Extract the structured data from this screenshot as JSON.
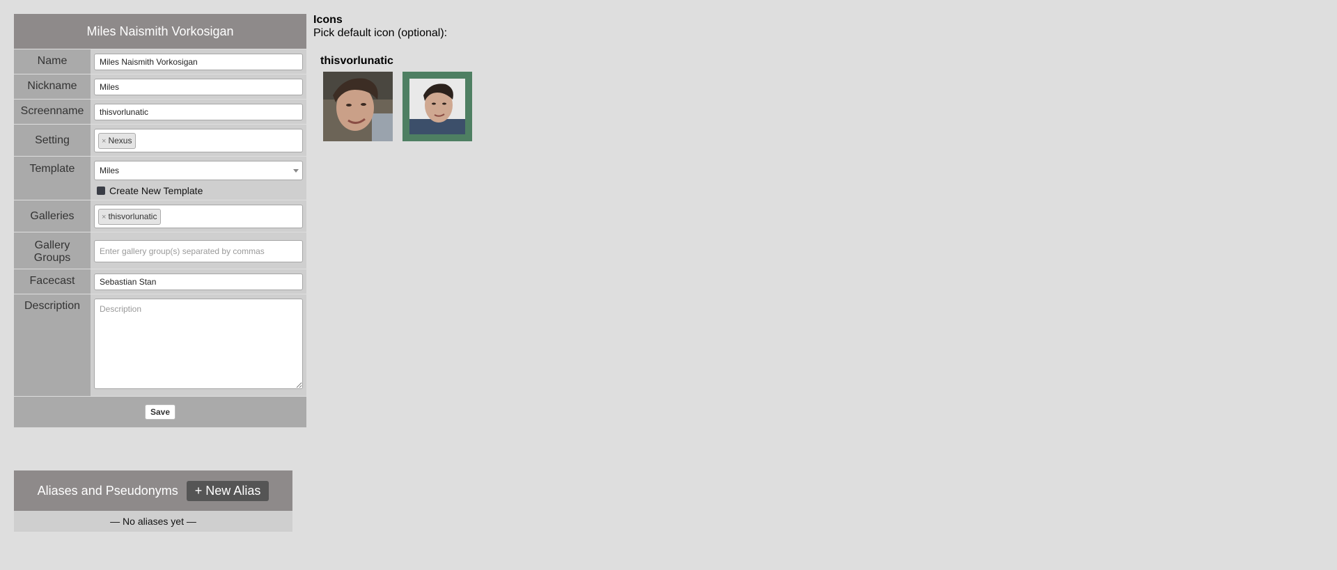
{
  "form": {
    "title": "Miles Naismith Vorkosigan",
    "fields": {
      "name": {
        "label": "Name",
        "value": "Miles Naismith Vorkosigan"
      },
      "nickname": {
        "label": "Nickname",
        "value": "Miles"
      },
      "screenname": {
        "label": "Screenname",
        "value": "thisvorlunatic"
      },
      "setting": {
        "label": "Setting",
        "tags": [
          "Nexus"
        ]
      },
      "template": {
        "label": "Template",
        "value": "Miles",
        "checkbox_label": "Create New Template"
      },
      "galleries": {
        "label": "Galleries",
        "tags": [
          "thisvorlunatic"
        ]
      },
      "gallery_groups": {
        "label": "Gallery Groups",
        "placeholder": "Enter gallery group(s) separated by commas"
      },
      "facecast": {
        "label": "Facecast",
        "value": "Sebastian Stan"
      },
      "description": {
        "label": "Description",
        "placeholder": "Description"
      }
    },
    "save_label": "Save",
    "tag_remove": "×"
  },
  "aliases": {
    "title": "Aliases and Pseudonyms",
    "new_button": "+ New Alias",
    "empty_text": "— No aliases yet —"
  },
  "icons": {
    "title": "Icons",
    "subtitle": "Pick default icon (optional):",
    "gallery_name": "thisvorlunatic",
    "selected_index": 1,
    "items": [
      {
        "icon": "portrait-icon"
      },
      {
        "icon": "portrait-icon"
      }
    ],
    "selected_border_color": "#4e7f62"
  }
}
